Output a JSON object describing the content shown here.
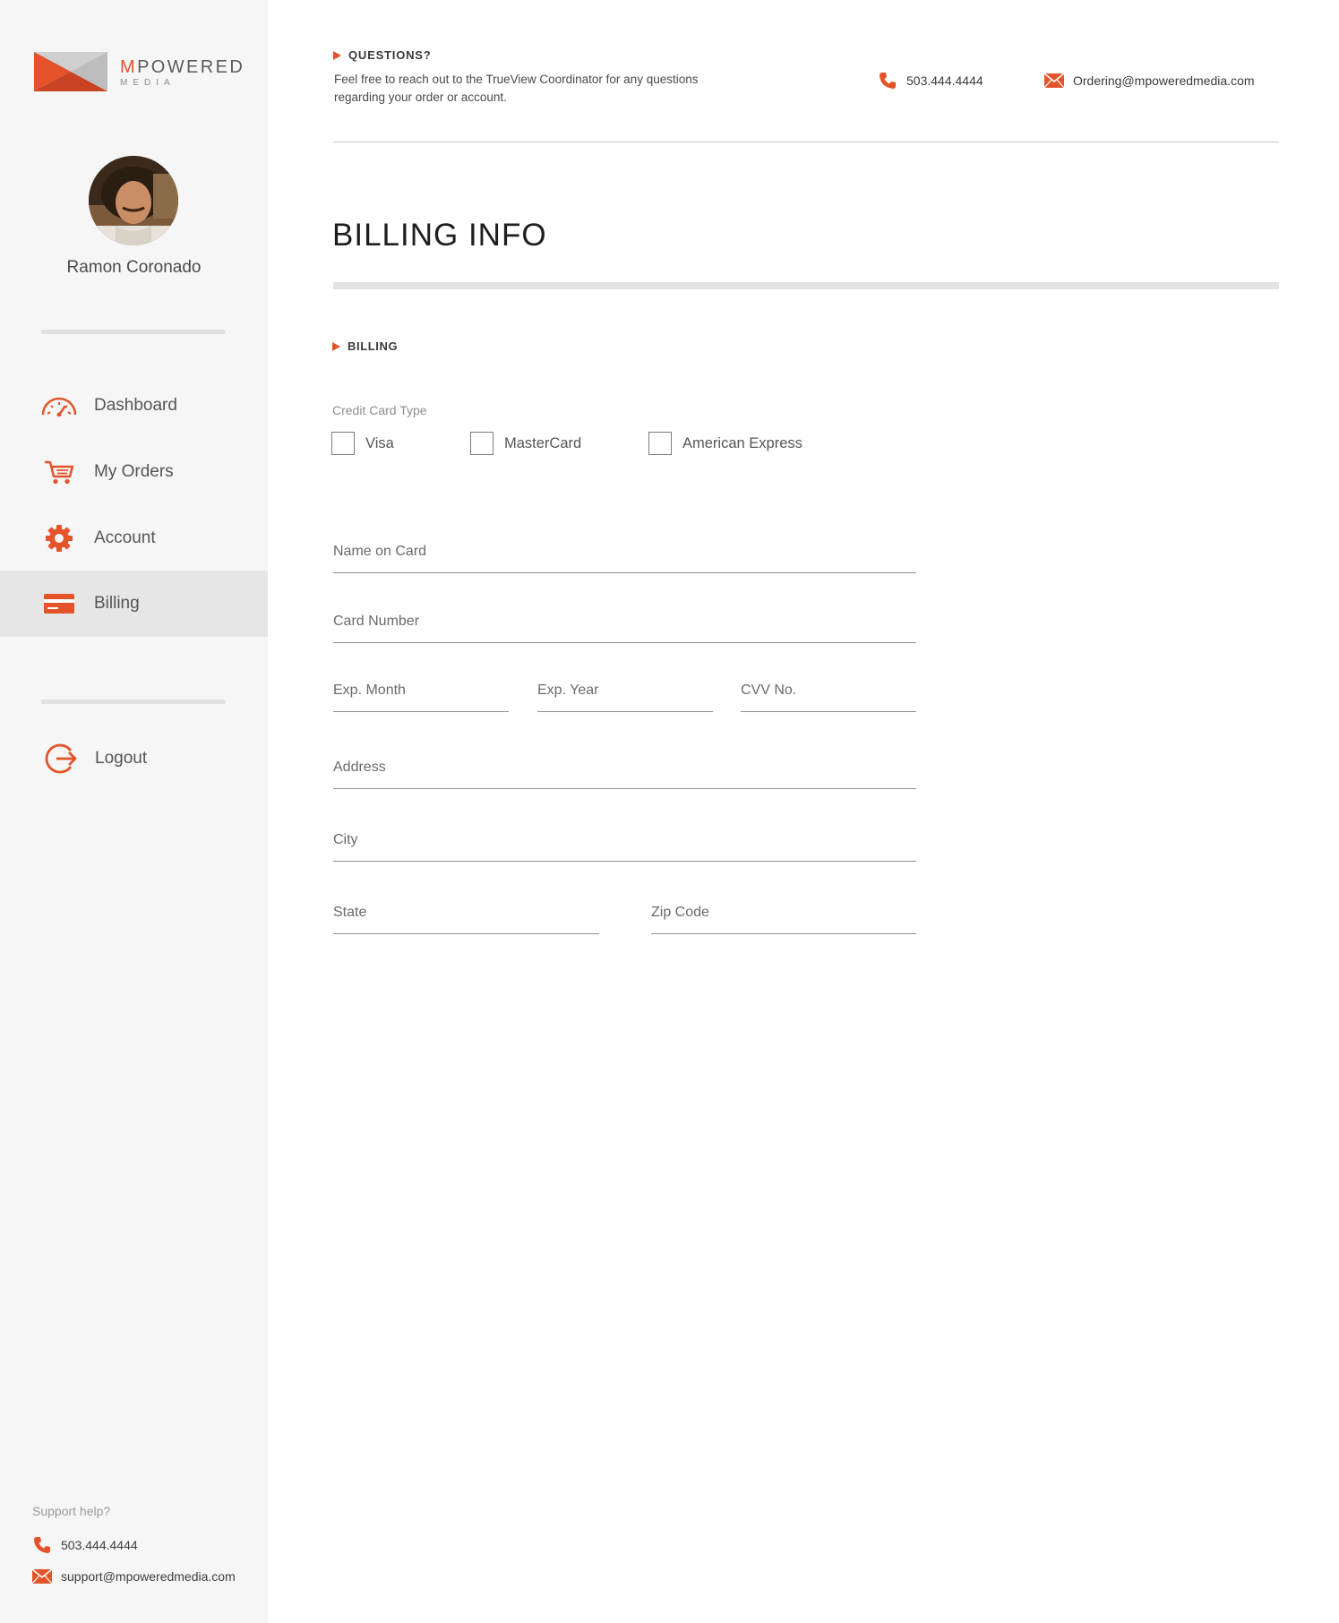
{
  "brand": {
    "name_first": "M",
    "name_rest": "POWERED",
    "sub": "MEDIA",
    "accent_color": "#e4532a"
  },
  "user": {
    "name": "Ramon Coronado"
  },
  "nav": {
    "items": [
      {
        "label": "Dashboard",
        "icon": "speedometer-icon"
      },
      {
        "label": "My Orders",
        "icon": "cart-icon"
      },
      {
        "label": "Account",
        "icon": "gear-icon"
      },
      {
        "label": "Billing",
        "icon": "credit-card-icon"
      }
    ],
    "logout": {
      "label": "Logout",
      "icon": "logout-icon"
    }
  },
  "support": {
    "title": "Support help?",
    "phone": "503.444.4444",
    "email": "support@mpoweredmedia.com"
  },
  "header": {
    "questions_title": "QUESTIONS?",
    "questions_text": "Feel free to reach out to the TrueView Coordinator for any questions regarding your order or account.",
    "phone": "503.444.4444",
    "email": "Ordering@mpoweredmedia.com"
  },
  "page": {
    "title": "BILLING INFO",
    "section": "BILLING"
  },
  "billing": {
    "card_type_label": "Credit Card Type",
    "card_types": [
      "Visa",
      "MasterCard",
      "American Express"
    ],
    "fields": {
      "name_on_card": "Name on Card",
      "card_number": "Card Number",
      "exp_month": "Exp. Month",
      "exp_year": "Exp. Year",
      "cvv": "CVV No.",
      "address": "Address",
      "city": "City",
      "state": "State",
      "zip": "Zip Code"
    }
  }
}
